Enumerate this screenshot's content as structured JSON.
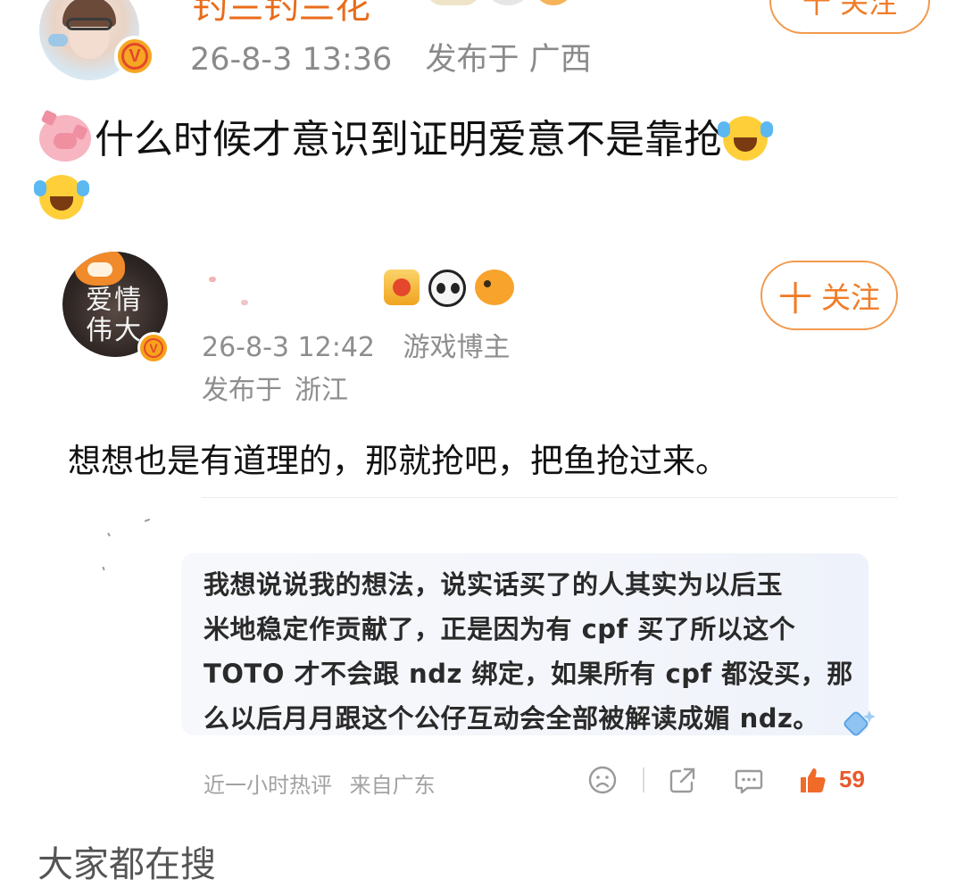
{
  "top_post": {
    "username": "钓兰钓兰花",
    "timestamp": "26-8-3 13:36",
    "published_at_label": "发布于",
    "location": "广西",
    "follow_label": "十 关注",
    "text": "什么时候才意识到证明爱意不是靠抢",
    "emojis": [
      "pig-emoji",
      "laugh-cry-emoji",
      "laugh-cry-emoji"
    ]
  },
  "embedded_post": {
    "avatar_text": "爱情伟大",
    "timestamp": "26-8-3 12:42",
    "role": "游戏博主",
    "published_at_label": "发布于",
    "location": "浙江",
    "follow_plus": "十",
    "follow_label": "关注",
    "text": "想想也是有道理的，那就抢吧，把鱼抢过来。",
    "badges": [
      "crown-badge-icon",
      "panda-badge-icon",
      "pufferfish-badge-icon"
    ]
  },
  "quoted_comment": {
    "lines": [
      "我想说说我的想法，说实话买了的人其实为以后玉",
      "米地稳定作贡献了，正是因为有 cpf 买了所以这个",
      "TOTO 才不会跟 ndz 绑定，如果所有 cpf 都没买，那",
      "么以后月月跟这个公仔互动会全部被解读成媚 ndz。"
    ],
    "footer_hot": "近一小时热评",
    "footer_from": "来自广东",
    "like_count": "59"
  },
  "bottom": {
    "section_title": "大家都在搜"
  },
  "colors": {
    "accent_orange": "#f07d2a",
    "meta_gray": "#8e8e8e",
    "like_red": "#e8592a",
    "verified_gold": "#f5a623"
  }
}
